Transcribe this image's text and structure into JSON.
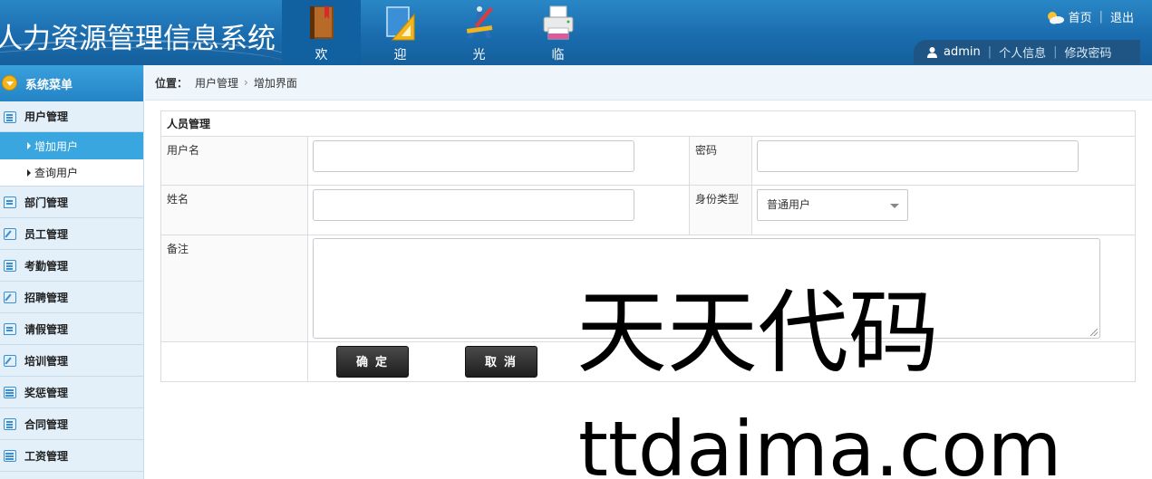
{
  "header": {
    "system_title": "人力资源管理信息系统",
    "nav": [
      {
        "label": "欢",
        "icon": "book-icon"
      },
      {
        "label": "迎",
        "icon": "ruler-icon"
      },
      {
        "label": "光",
        "icon": "drafting-tools-icon"
      },
      {
        "label": "临",
        "icon": "printer-icon"
      }
    ],
    "home_link": "首页",
    "logout_link": "退出",
    "username": "admin",
    "profile_link": "个人信息",
    "change_password_link": "修改密码"
  },
  "sidebar": {
    "heading": "系统菜单",
    "groups": [
      {
        "label": "用户管理",
        "icon": "list-icon",
        "children": [
          {
            "label": "增加用户",
            "active": true
          },
          {
            "label": "查询用户",
            "active": false
          }
        ]
      },
      {
        "label": "部门管理",
        "icon": "chat-icon"
      },
      {
        "label": "员工管理",
        "icon": "edit-icon"
      },
      {
        "label": "考勤管理",
        "icon": "list-icon"
      },
      {
        "label": "招聘管理",
        "icon": "edit-icon"
      },
      {
        "label": "请假管理",
        "icon": "chat-icon"
      },
      {
        "label": "培训管理",
        "icon": "edit-icon"
      },
      {
        "label": "奖惩管理",
        "icon": "calendar-icon"
      },
      {
        "label": "合同管理",
        "icon": "list-icon"
      },
      {
        "label": "工资管理",
        "icon": "calendar-icon"
      }
    ]
  },
  "breadcrumb": {
    "prefix": "位置：",
    "items": [
      "用户管理",
      "增加界面"
    ],
    "separator": "›"
  },
  "form": {
    "title": "人员管理",
    "username_label": "用户名",
    "username_value": "",
    "password_label": "密码",
    "password_value": "",
    "name_label": "姓名",
    "name_value": "",
    "role_label": "身份类型",
    "role_selected": "普通用户",
    "remark_label": "备注",
    "remark_value": "",
    "confirm_button": "确定",
    "cancel_button": "取消"
  },
  "watermark": {
    "line1": "天天代码",
    "line2": "ttdaima.com"
  },
  "colors": {
    "header_blue": "#1a6cae",
    "sidebar_bg": "#e3f0fa",
    "active_item": "#3aa6e0",
    "button_dark": "#2a2a2a"
  }
}
